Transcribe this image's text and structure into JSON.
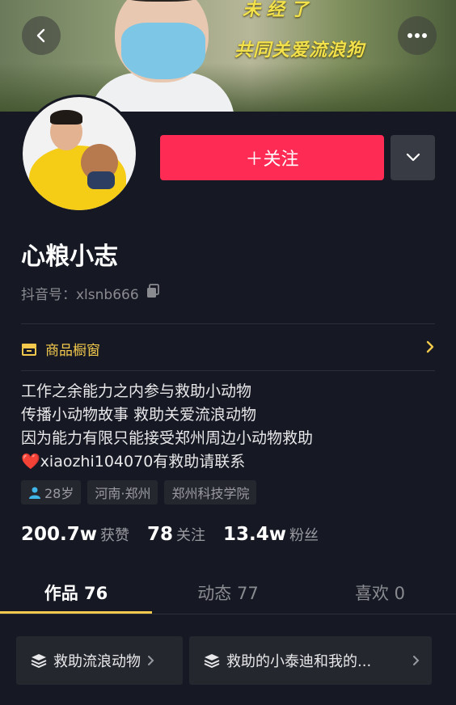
{
  "banner": {
    "caption_top": "未 经 了",
    "caption": "共同关爱流浪狗"
  },
  "header": {
    "back_icon": "chevron-left-icon",
    "more_icon": "more-dots-icon"
  },
  "profile": {
    "follow_label": "＋关注",
    "name": "心粮小志",
    "douyin_id_label": "抖音号：",
    "douyin_id": "xlsnb666"
  },
  "shop": {
    "label": "商品橱窗"
  },
  "bio": {
    "line1": "工作之余能力之内参与救助小动物",
    "line2": "传播小动物故事 救助关爱流浪动物",
    "line3": "因为能力有限只能接受郑州周边小动物救助",
    "line4_heart": "❤️",
    "line4": "xiaozhi104070有救助请联系"
  },
  "tags": {
    "age": "28岁",
    "location": "河南·郑州",
    "school": "郑州科技学院"
  },
  "stats": {
    "likes_value": "200.7w",
    "likes_label": "获赞",
    "following_value": "78",
    "following_label": "关注",
    "followers_value": "13.4w",
    "followers_label": "粉丝"
  },
  "tabs": {
    "works": "作品 76",
    "dynamics": "动态 77",
    "likes": "喜欢 0"
  },
  "collections": {
    "item1": "救助流浪动物",
    "item2": "救助的小泰迪和我的..."
  },
  "colors": {
    "accent": "#fe2c55",
    "gold": "#f2c94c",
    "background": "#161823"
  }
}
